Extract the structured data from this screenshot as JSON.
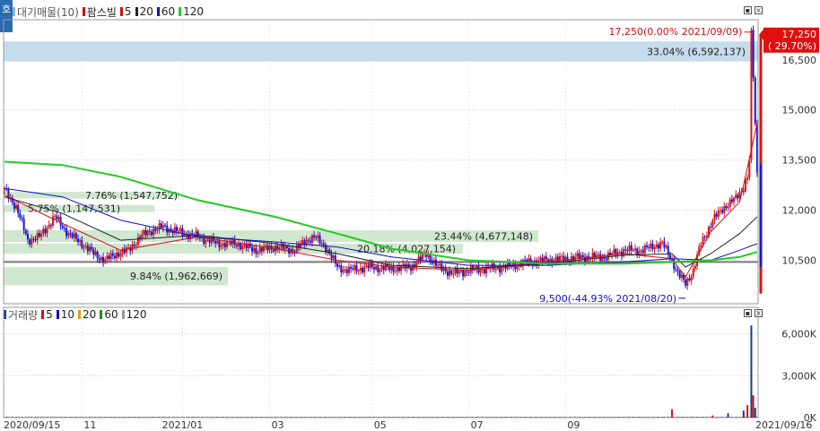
{
  "price_panel": {
    "legend": [
      {
        "label": "대기매물(10)",
        "color": "#8ab4d8"
      },
      {
        "label": "팜스빌",
        "color": "#d01010"
      },
      {
        "label": "5",
        "color": "#d01010"
      },
      {
        "label": "20",
        "color": "#222222"
      },
      {
        "label": "60",
        "color": "#1010c0"
      },
      {
        "label": "120",
        "color": "#22cc22"
      }
    ],
    "side_tab": "호",
    "max_annotation": "17,250(0.00% 2021/09/09)",
    "min_annotation": "9,500(-44.93% 2021/08/20)",
    "current_price": "17,250",
    "current_change": "( 29.70%)"
  },
  "volume_panel": {
    "legend": [
      {
        "label": "거래량",
        "color": "#1a3a8a"
      },
      {
        "label": "5",
        "color": "#d01010"
      },
      {
        "label": "10",
        "color": "#1010c0"
      },
      {
        "label": "20",
        "color": "#d0a010"
      },
      {
        "label": "60",
        "color": "#228822"
      },
      {
        "label": "120",
        "color": "#999999"
      }
    ]
  },
  "colors": {
    "up": "#e01010",
    "down": "#1818d0",
    "ma5": "#d01010",
    "ma20": "#222222",
    "ma60": "#1010c0",
    "ma120": "#22cc22",
    "overhang_blue": "#c5dcec",
    "overhang_green": "#cfe8cf"
  },
  "chart_data": [
    {
      "type": "candlestick",
      "title": "",
      "y_axis": {
        "ticks": [
          10500,
          12000,
          13500,
          15000,
          16500
        ],
        "tick_labels": [
          "10,500",
          "12,000",
          "13,500",
          "15,000",
          "16,500"
        ],
        "range": [
          9200,
          17700
        ],
        "side": "right"
      },
      "x_axis": {
        "tick_labels": [
          "2020/09/15",
          "11",
          "2021/01",
          "03",
          "05",
          "07",
          "09",
          "2021/09/16"
        ]
      },
      "reference_line": 10450,
      "price_path": [
        [
          0,
          12600
        ],
        [
          6,
          12100
        ],
        [
          12,
          11100
        ],
        [
          18,
          11200
        ],
        [
          26,
          11800
        ],
        [
          33,
          11300
        ],
        [
          40,
          11000
        ],
        [
          46,
          10700
        ],
        [
          52,
          10500
        ],
        [
          58,
          10700
        ],
        [
          64,
          10800
        ],
        [
          70,
          11200
        ],
        [
          76,
          11400
        ],
        [
          82,
          11500
        ],
        [
          90,
          11350
        ],
        [
          100,
          11200
        ],
        [
          110,
          11000
        ],
        [
          120,
          11000
        ],
        [
          130,
          10800
        ],
        [
          140,
          10900
        ],
        [
          150,
          10800
        ],
        [
          156,
          11100
        ],
        [
          160,
          11200
        ],
        [
          166,
          10900
        ],
        [
          172,
          10300
        ],
        [
          178,
          10200
        ],
        [
          188,
          10300
        ],
        [
          200,
          10250
        ],
        [
          210,
          10300
        ],
        [
          218,
          10700
        ],
        [
          224,
          10300
        ],
        [
          232,
          10100
        ],
        [
          240,
          10200
        ],
        [
          250,
          10250
        ],
        [
          260,
          10300
        ],
        [
          270,
          10450
        ],
        [
          280,
          10500
        ],
        [
          290,
          10550
        ],
        [
          300,
          10600
        ],
        [
          310,
          10600
        ],
        [
          320,
          10800
        ],
        [
          330,
          10800
        ],
        [
          336,
          10950
        ],
        [
          340,
          11000
        ],
        [
          345,
          10500
        ],
        [
          348,
          10100
        ],
        [
          352,
          9800
        ],
        [
          356,
          10200
        ],
        [
          360,
          11000
        ],
        [
          366,
          11700
        ],
        [
          372,
          12100
        ],
        [
          378,
          12350
        ],
        [
          382,
          12700
        ],
        [
          384,
          13000
        ],
        [
          385,
          13500
        ],
        [
          386,
          17250
        ],
        [
          387,
          16000
        ],
        [
          389,
          13100
        ]
      ],
      "overhang_bands": [
        {
          "label": "33.04% (6,592,137)",
          "low": 16450,
          "high": 17050,
          "color": "blue"
        },
        {
          "label": "7.76% (1,547,752)",
          "low": 12350,
          "high": 12550,
          "color": "green"
        },
        {
          "label": "5.75% (1,147,531)",
          "low": 11950,
          "high": 12150,
          "color": "green"
        },
        {
          "label": "23.44% (4,677,148)",
          "low": 11050,
          "high": 11400,
          "color": "green"
        },
        {
          "label": "20.18% (4,027,154)",
          "low": 10700,
          "high": 11000,
          "color": "green"
        },
        {
          "label": "9.84% (1,962,669)",
          "low": 9750,
          "high": 10300,
          "color": "green"
        }
      ],
      "ma_series": {
        "ma5": [
          [
            0,
            12450
          ],
          [
            30,
            11600
          ],
          [
            60,
            10800
          ],
          [
            100,
            11200
          ],
          [
            140,
            10850
          ],
          [
            172,
            10500
          ],
          [
            200,
            10300
          ],
          [
            240,
            10200
          ],
          [
            280,
            10450
          ],
          [
            320,
            10700
          ],
          [
            345,
            10550
          ],
          [
            352,
            10000
          ],
          [
            365,
            11350
          ],
          [
            380,
            12250
          ],
          [
            386,
            13800
          ],
          [
            389,
            14600
          ]
        ],
        "ma20": [
          [
            0,
            12400
          ],
          [
            30,
            11900
          ],
          [
            60,
            11100
          ],
          [
            100,
            11250
          ],
          [
            140,
            11000
          ],
          [
            172,
            10700
          ],
          [
            200,
            10350
          ],
          [
            240,
            10250
          ],
          [
            280,
            10400
          ],
          [
            320,
            10650
          ],
          [
            345,
            10700
          ],
          [
            352,
            10300
          ],
          [
            365,
            10700
          ],
          [
            380,
            11300
          ],
          [
            389,
            11800
          ]
        ],
        "ma60": [
          [
            0,
            12650
          ],
          [
            30,
            12400
          ],
          [
            60,
            11700
          ],
          [
            100,
            11200
          ],
          [
            140,
            11050
          ],
          [
            172,
            10900
          ],
          [
            200,
            10600
          ],
          [
            240,
            10350
          ],
          [
            280,
            10350
          ],
          [
            320,
            10450
          ],
          [
            345,
            10550
          ],
          [
            365,
            10500
          ],
          [
            380,
            10800
          ],
          [
            389,
            11000
          ]
        ],
        "ma120": [
          [
            0,
            13450
          ],
          [
            30,
            13350
          ],
          [
            60,
            13000
          ],
          [
            100,
            12300
          ],
          [
            140,
            11800
          ],
          [
            172,
            11300
          ],
          [
            200,
            10850
          ],
          [
            240,
            10500
          ],
          [
            280,
            10400
          ],
          [
            320,
            10400
          ],
          [
            345,
            10450
          ],
          [
            365,
            10500
          ],
          [
            380,
            10600
          ],
          [
            389,
            10750
          ]
        ]
      },
      "extremes": {
        "max": 17250,
        "max_date": "2021/09/09",
        "min": 9500,
        "min_date": "2021/08/20"
      }
    },
    {
      "type": "bar",
      "title": "",
      "y_axis": {
        "ticks": [
          0,
          3000,
          6000
        ],
        "tick_labels": [
          "0K",
          "3,000K",
          "6,000K"
        ],
        "range": [
          0,
          7000
        ]
      },
      "spikes": [
        [
          345,
          600
        ],
        [
          366,
          150
        ],
        [
          374,
          300
        ],
        [
          382,
          500
        ],
        [
          384,
          900
        ],
        [
          386,
          6600
        ],
        [
          387,
          1600
        ],
        [
          388,
          700
        ]
      ],
      "base_level": 20
    }
  ]
}
